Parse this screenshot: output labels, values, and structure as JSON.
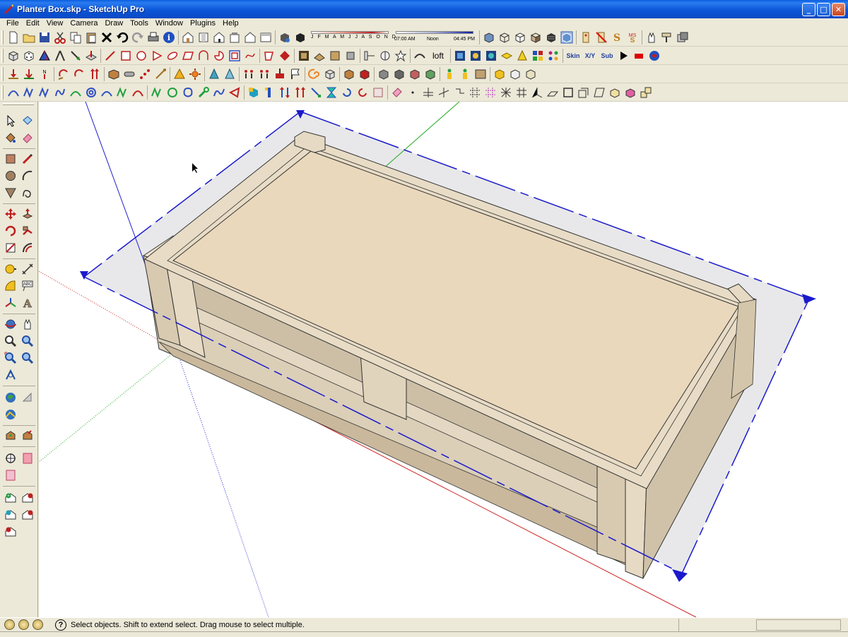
{
  "window": {
    "title": "Planter Box.skp - SketchUp Pro",
    "minimize": "_",
    "maximize": "□",
    "close": "✕"
  },
  "menu": [
    "File",
    "Edit",
    "View",
    "Camera",
    "Draw",
    "Tools",
    "Window",
    "Plugins",
    "Help"
  ],
  "shadow_settings": {
    "months": "J F M A M J J A S O N D",
    "time_start": "07:00 AM",
    "time_mid": "Noon",
    "time_end": "04:45 PM"
  },
  "plugin_buttons": {
    "loft": "loft",
    "skin": "Skin",
    "xyz": "X/Y",
    "sub": "Sub"
  },
  "status": {
    "help_symbol": "?",
    "message": "Select objects. Shift to extend select. Drag mouse to select multiple."
  },
  "colors": {
    "canvas_bg": "#ffffff",
    "box_top": "#ead8bc",
    "box_side": "#d8cbb4",
    "section_plane": "#1a1acc",
    "axis_red": "#cc2222",
    "axis_green": "#22aa22",
    "axis_blue": "#2222cc"
  }
}
